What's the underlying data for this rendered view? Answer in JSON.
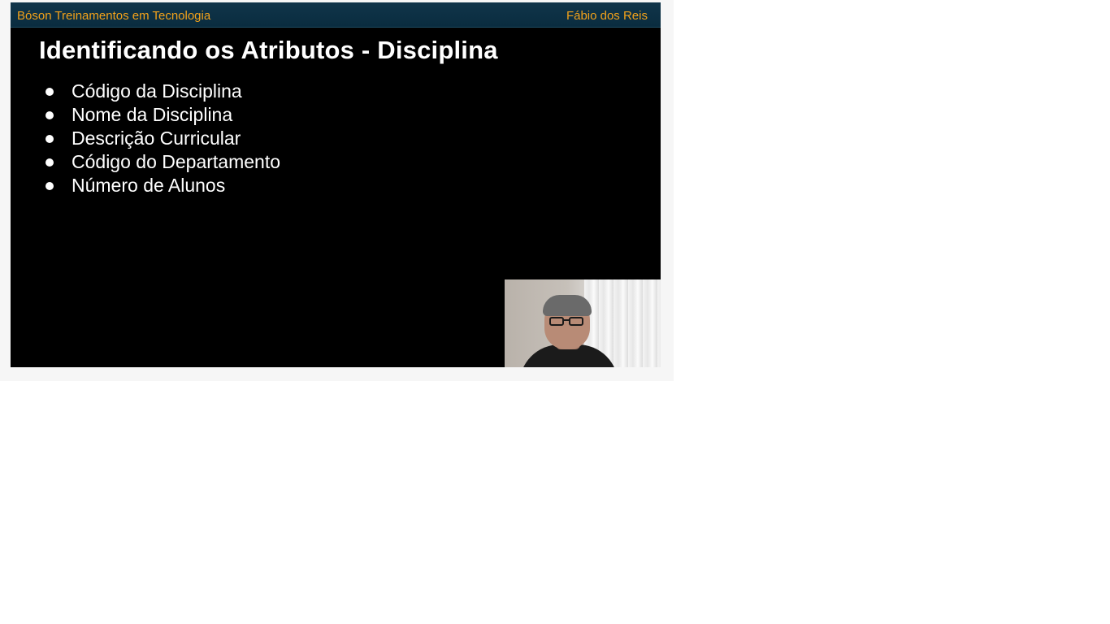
{
  "header": {
    "brand": "Bóson Treinamentos em Tecnologia",
    "author": "Fábio dos Reis"
  },
  "slide": {
    "title": "Identificando os Atributos - Disciplina",
    "bullets": [
      "Código da Disciplina",
      "Nome da Disciplina",
      "Descrição Curricular",
      "Código do Departamento",
      "Número de Alunos"
    ]
  },
  "colors": {
    "header_bg": "#0e3247",
    "header_text": "#f3a21a",
    "slide_bg": "#000000",
    "slide_text": "#ffffff"
  },
  "icons": {
    "bullet": "filled-circle",
    "webcam": "presenter-webcam-overlay"
  }
}
